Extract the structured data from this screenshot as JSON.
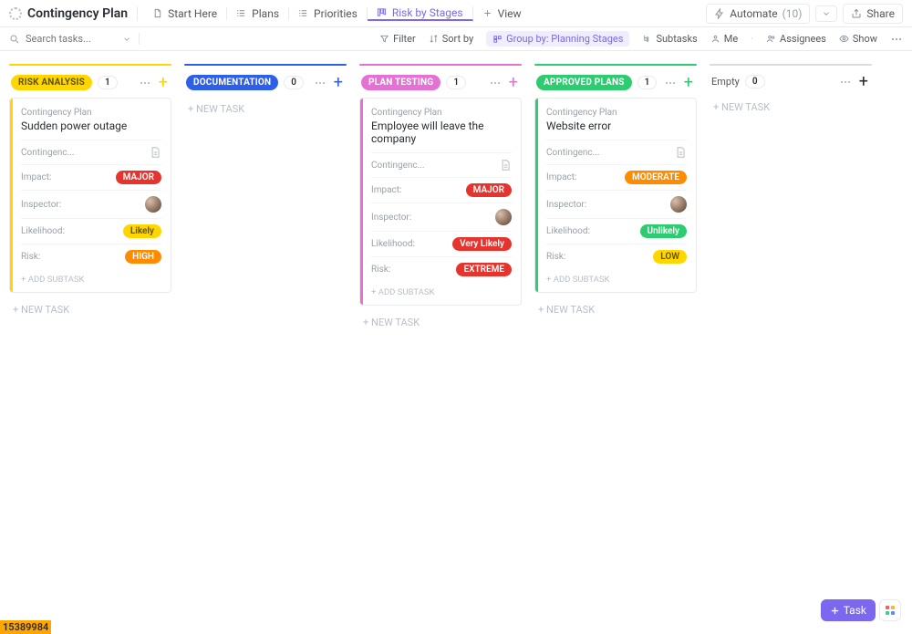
{
  "header": {
    "title": "Contingency Plan",
    "tabs": [
      {
        "label": "Start Here",
        "icon": "doc"
      },
      {
        "label": "Plans",
        "icon": "list"
      },
      {
        "label": "Priorities",
        "icon": "list"
      },
      {
        "label": "Risk by Stages",
        "icon": "board",
        "active": true
      },
      {
        "label": "View",
        "icon": "plus"
      }
    ],
    "automate": {
      "label": "Automate",
      "count": "(10)"
    },
    "share": "Share"
  },
  "filters": {
    "search_placeholder": "Search tasks...",
    "filter": "Filter",
    "sort": "Sort by",
    "group": "Group by: Planning Stages",
    "subtasks": "Subtasks",
    "me": "Me",
    "assignees": "Assignees",
    "show": "Show"
  },
  "columns": [
    {
      "status": "RISK ANALYSIS",
      "count": "1",
      "color": "#ffd600",
      "text_color": "#5b5200",
      "plus_color": "#ffd600",
      "cards": [
        {
          "pre": "Contingency Plan",
          "title": "Sudden power outage",
          "sector_label": "Contingenc...",
          "impact": {
            "label": "Impact:",
            "value": "MAJOR",
            "bg": "#e5342e"
          },
          "inspector": {
            "label": "Inspector:"
          },
          "likelihood": {
            "label": "Likelihood:",
            "value": "Likely",
            "bg": "#ffd600",
            "fg": "#5b5200"
          },
          "risk": {
            "label": "Risk:",
            "value": "HIGH",
            "bg": "#ff8c00"
          },
          "add_subtask": "+ ADD SUBTASK"
        }
      ],
      "new_task": "+ NEW TASK"
    },
    {
      "status": "DOCUMENTATION",
      "count": "0",
      "color": "#2e5fe8",
      "text_color": "#ffffff",
      "plus_color": "#2e5fe8",
      "cards": [],
      "new_task": "+ NEW TASK"
    },
    {
      "status": "PLAN TESTING",
      "count": "1",
      "color": "#e571d5",
      "text_color": "#ffffff",
      "plus_color": "#e571d5",
      "cards": [
        {
          "pre": "Contingency Plan",
          "title": "Employee will leave the company",
          "sector_label": "Contingenc...",
          "impact": {
            "label": "Impact:",
            "value": "MAJOR",
            "bg": "#e5342e"
          },
          "inspector": {
            "label": "Inspector:"
          },
          "likelihood": {
            "label": "Likelihood:",
            "value": "Very Likely",
            "bg": "#e5342e",
            "fg": "#fff"
          },
          "risk": {
            "label": "Risk:",
            "value": "EXTREME",
            "bg": "#e5342e"
          },
          "add_subtask": "+ ADD SUBTASK"
        }
      ],
      "new_task": "+ NEW TASK"
    },
    {
      "status": "APPROVED PLANS",
      "count": "1",
      "color": "#2ecc71",
      "text_color": "#ffffff",
      "plus_color": "#2ecc71",
      "cards": [
        {
          "pre": "Contingency Plan",
          "title": "Website error",
          "sector_label": "Contingenc...",
          "impact": {
            "label": "Impact:",
            "value": "MODERATE",
            "bg": "#ff8c00"
          },
          "inspector": {
            "label": "Inspector:"
          },
          "likelihood": {
            "label": "Likelihood:",
            "value": "Unlikely",
            "bg": "#2ecc71",
            "fg": "#fff"
          },
          "risk": {
            "label": "Risk:",
            "value": "LOW",
            "bg": "#ffd600",
            "fg": "#5b5200"
          },
          "add_subtask": "+ ADD SUBTASK"
        }
      ],
      "new_task": "+ NEW TASK"
    },
    {
      "status": "Empty",
      "count": "0",
      "color": "#d9dce1",
      "empty": true,
      "plus_color": "#2a2e34",
      "cards": [],
      "new_task": "+ NEW TASK"
    }
  ],
  "footer": {
    "id_tag": "15389984",
    "task_fab": "Task"
  }
}
